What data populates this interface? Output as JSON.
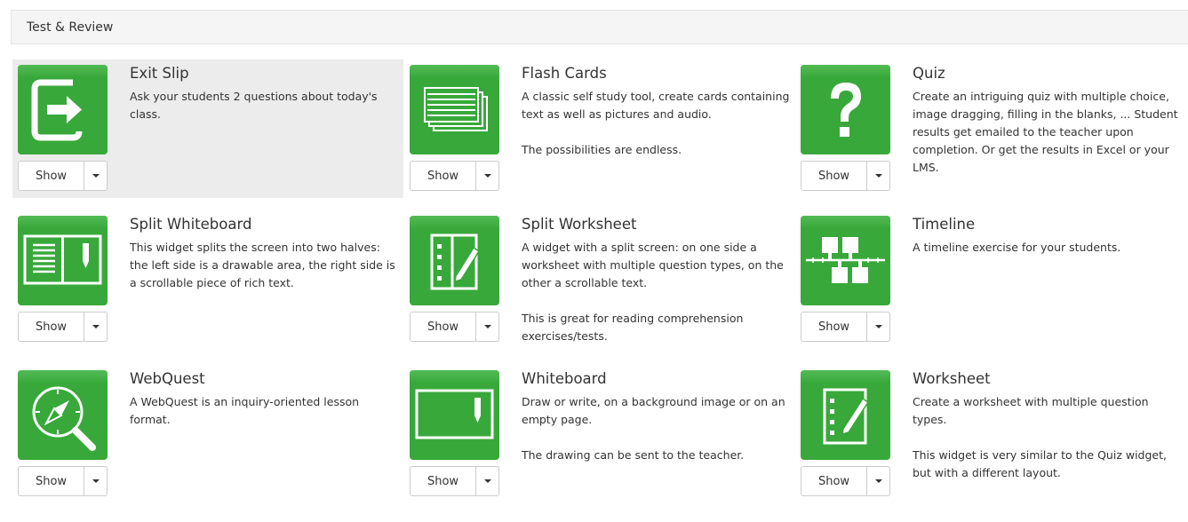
{
  "section": {
    "title": "Test & Review"
  },
  "widgets": [
    {
      "title": "Exit Slip",
      "icon": "exit-icon",
      "desc": [
        "Ask your students 2 questions about today's class."
      ],
      "show_label": "Show"
    },
    {
      "title": "Flash Cards",
      "icon": "cards-stack-icon",
      "desc": [
        "A classic self study tool, create cards containing text as well as pictures and audio.",
        "The possibilities are endless."
      ],
      "show_label": "Show"
    },
    {
      "title": "Quiz",
      "icon": "question-mark-icon",
      "desc": [
        "Create an intriguing quiz with multiple choice, image dragging, filling in the blanks, ... Student results get emailed to the teacher upon completion. Or get the results in Excel or your LMS."
      ],
      "show_label": "Show"
    },
    {
      "title": "Split Whiteboard",
      "icon": "split-whiteboard-icon",
      "desc": [
        "This widget splits the screen into two halves: the left side is a drawable area, the right side is a scrollable piece of rich text."
      ],
      "show_label": "Show"
    },
    {
      "title": "Split Worksheet",
      "icon": "split-worksheet-icon",
      "desc": [
        "A widget with a split screen: on one side a worksheet with multiple question types, on the other a scrollable text.",
        "This is great for reading comprehension exercises/tests."
      ],
      "show_label": "Show"
    },
    {
      "title": "Timeline",
      "icon": "timeline-icon",
      "desc": [
        "A timeline exercise for your students."
      ],
      "show_label": "Show"
    },
    {
      "title": "WebQuest",
      "icon": "compass-magnifier-icon",
      "desc": [
        "A WebQuest is an inquiry-oriented lesson format."
      ],
      "show_label": "Show"
    },
    {
      "title": "Whiteboard",
      "icon": "whiteboard-icon",
      "desc": [
        "Draw or write, on a background image or on an empty page.",
        "The drawing can be sent to the teacher."
      ],
      "show_label": "Show"
    },
    {
      "title": "Worksheet",
      "icon": "worksheet-icon",
      "desc": [
        "Create a worksheet with multiple question types.",
        "This widget is very similar to the Quiz widget, but with a different layout."
      ],
      "show_label": "Show"
    }
  ],
  "colors": {
    "tile_green": "#38a83a",
    "highlight_bg": "#ececec"
  }
}
